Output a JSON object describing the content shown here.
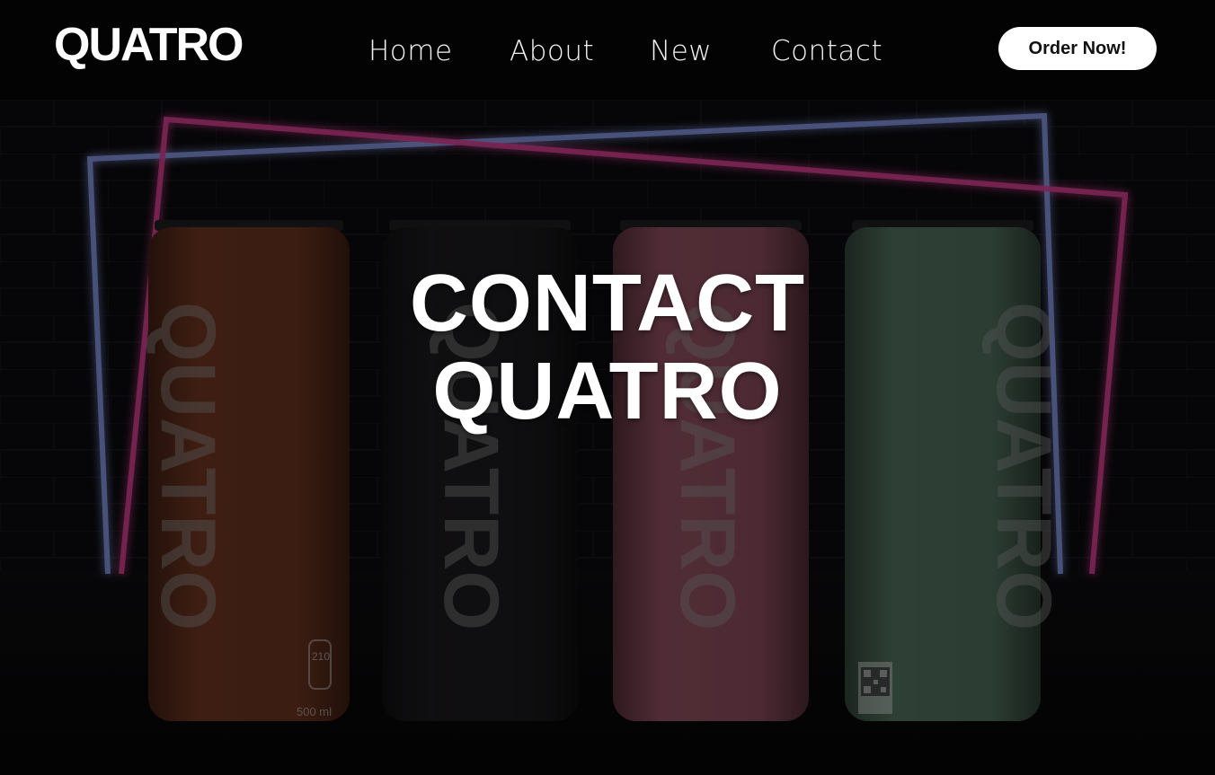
{
  "brand": {
    "logo": "QUATRO"
  },
  "nav": {
    "items": [
      {
        "label": "Home"
      },
      {
        "label": "About"
      },
      {
        "label": "New"
      },
      {
        "label": "Contact"
      }
    ],
    "cta_label": "Order Now!"
  },
  "hero": {
    "title_line1": "CONTACT",
    "title_line2": "QUATRO",
    "can_brand": "QUATRO",
    "can_label_calories": "210",
    "can_label_volume": "500 ml"
  },
  "colors": {
    "header_bg": "#030303",
    "neon_pink": "#d23a8c",
    "neon_blue": "#6f86ff",
    "can_orange": "#6a3420",
    "can_dark": "#1b1a1d",
    "can_pink": "#8a4c5c",
    "can_green": "#4f6e5c"
  },
  "icons": [
    "qr-code-icon"
  ]
}
